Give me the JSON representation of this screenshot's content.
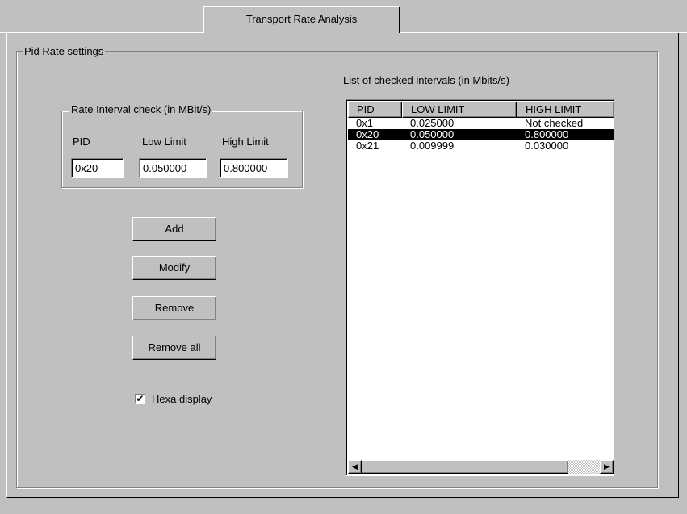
{
  "tab": {
    "label": "Transport Rate Analysis"
  },
  "pid_rate_group": {
    "title": "Pid Rate settings"
  },
  "interval_group": {
    "title": "Rate Interval check (in MBit/s)",
    "pid_label": "PID",
    "low_label": "Low Limit",
    "high_label": "High Limit",
    "pid_value": "0x20",
    "low_value": "0.050000",
    "high_value": "0.800000"
  },
  "buttons": {
    "add": "Add",
    "modify": "Modify",
    "remove": "Remove",
    "remove_all": "Remove all"
  },
  "hexa_display": {
    "label": "Hexa display",
    "checked": true,
    "check_glyph": "✔"
  },
  "intervals_list": {
    "caption": "List of checked intervals (in Mbits/s)",
    "columns": [
      "PID",
      "LOW LIMIT",
      "HIGH LIMIT"
    ],
    "rows": [
      {
        "pid": "0x1",
        "low": "0.025000",
        "high": "Not checked",
        "selected": false
      },
      {
        "pid": "0x20",
        "low": "0.050000",
        "high": "0.800000",
        "selected": true
      },
      {
        "pid": "0x21",
        "low": "0.009999",
        "high": "0.030000",
        "selected": false
      }
    ],
    "scroll_left_glyph": "◀",
    "scroll_right_glyph": "▶"
  }
}
